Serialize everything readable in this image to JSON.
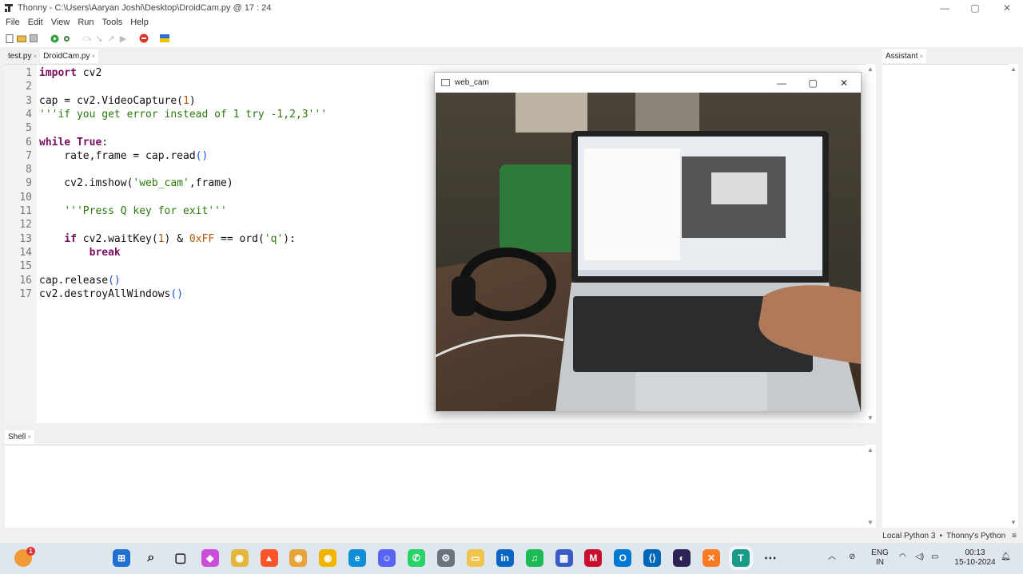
{
  "window": {
    "app_name": "Thonny",
    "path": "C:\\Users\\Aaryan Joshi\\Desktop\\DroidCam.py",
    "cursor": "17 : 24",
    "title": "Thonny  -  C:\\Users\\Aaryan Joshi\\Desktop\\DroidCam.py  @  17 : 24",
    "controls": [
      "minimize",
      "maximize",
      "close"
    ]
  },
  "menu": [
    "File",
    "Edit",
    "View",
    "Run",
    "Tools",
    "Help"
  ],
  "toolbar": [
    "new-file-icon",
    "open-file-icon",
    "save-icon",
    "run-icon",
    "debug-icon",
    "step-over-icon",
    "step-into-icon",
    "step-out-icon",
    "resume-icon",
    "stop-icon",
    "ukraine-flag-icon"
  ],
  "editor_tabs": [
    {
      "label": "test.py",
      "active": false
    },
    {
      "label": "DroidCam.py",
      "active": true
    }
  ],
  "code_lines": [
    "import cv2",
    "",
    "cap = cv2.VideoCapture(1)",
    "'''if you get error instead of 1 try -1,2,3'''",
    "",
    "while True:",
    "    rate,frame = cap.read()",
    "",
    "    cv2.imshow('web_cam',frame)",
    "",
    "    '''Press Q key for exit'''",
    "",
    "    if cv2.waitKey(1) & 0xFF == ord('q'):",
    "        break",
    "",
    "cap.release()",
    "cv2.destroyAllWindows()"
  ],
  "line_numbers": [
    "1",
    "2",
    "3",
    "4",
    "5",
    "6",
    "7",
    "8",
    "9",
    "10",
    "11",
    "12",
    "13",
    "14",
    "15",
    "16",
    "17"
  ],
  "shell_tab": "Shell",
  "assistant_tab": "Assistant",
  "statusbar": {
    "interpreter": "Local Python 3",
    "separator": "•",
    "env": "Thonny's Python",
    "menu_glyph": "≡"
  },
  "webcam_window": {
    "title": "web_cam"
  },
  "taskbar": {
    "weather_badge": "1",
    "language": {
      "line1": "ENG",
      "line2": "IN"
    },
    "time": "00:13",
    "date": "15-10-2024",
    "apps": [
      "start-icon",
      "search-icon",
      "task-view-icon",
      "copilot-icon",
      "chrome-icon",
      "brave-icon",
      "chrome-profile-icon",
      "chrome-profile2-icon",
      "edge-icon",
      "discord-icon",
      "whatsapp-icon",
      "settings-icon",
      "file-explorer-icon",
      "linkedin-icon",
      "spotify-icon",
      "store-icon",
      "mcafee-icon",
      "outlook-icon",
      "vscode-icon",
      "eclipse-icon",
      "xampp-icon",
      "thonny-icon",
      "more-icon"
    ]
  },
  "colors": {
    "keyword": "#7a0e5e",
    "string": "#2b7a0b",
    "number": "#b05a00",
    "paren": "#1c4fd6"
  }
}
